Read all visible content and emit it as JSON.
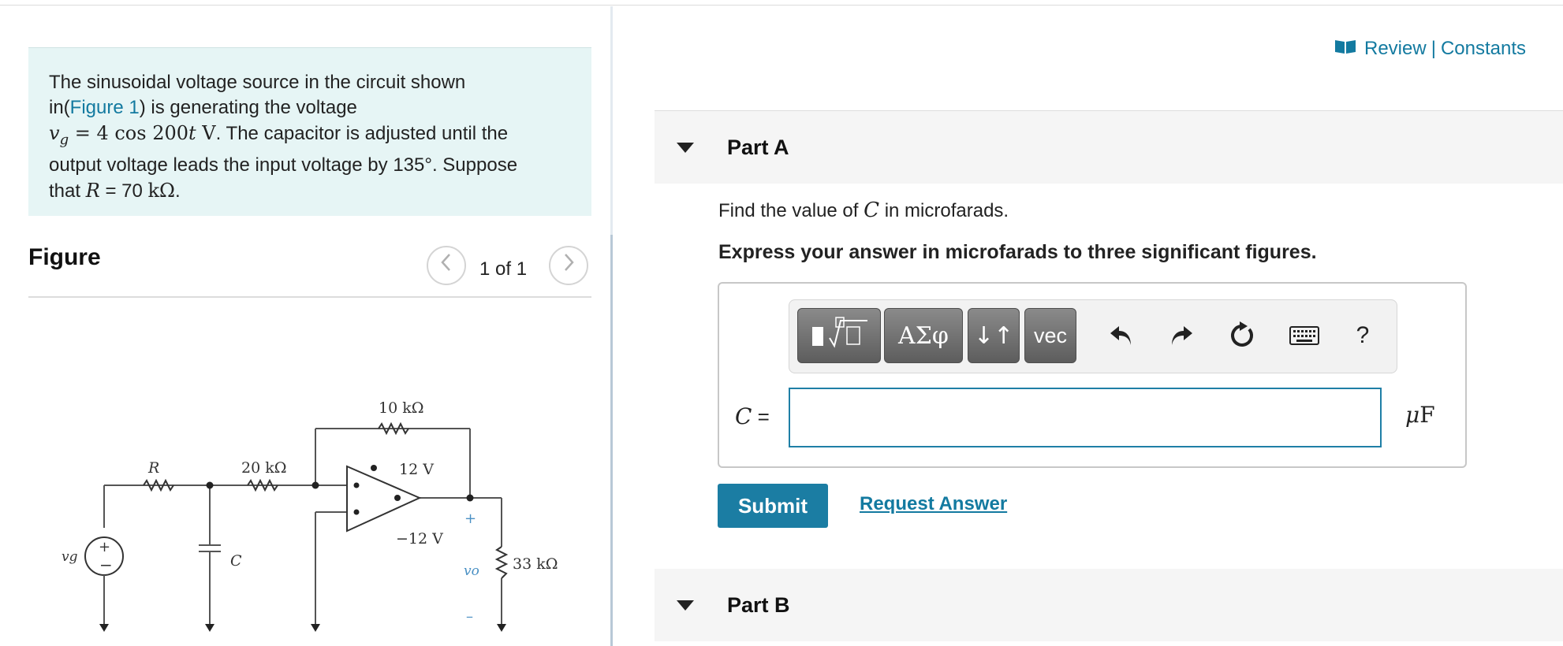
{
  "problem": {
    "line1": "The sinusoidal voltage source in the circuit shown",
    "line2_pre": "in(",
    "figure_link": "Figure 1",
    "line2_post": ") is generating the voltage",
    "math_vg": "v",
    "math_vg_sub": "g",
    "math_eq": " = 4 cos 200",
    "math_t": "t",
    "math_v": " V",
    "line3_post": ". The capacitor is adjusted until the",
    "line4": "output voltage leads the input voltage by 135°. Suppose",
    "line5_pre": "that ",
    "math_R": "R",
    "line5_eq": " = 70 ",
    "math_kohm": "kΩ",
    "line5_post": "."
  },
  "figure": {
    "title": "Figure",
    "pager_text": "1 of 1",
    "prev_icon": "chevron-left-icon",
    "next_icon": "chevron-right-icon",
    "labels": {
      "r_feedback": "10 kΩ",
      "r": "R",
      "r_20k": "20 kΩ",
      "v_pos": "12 V",
      "v_neg": "−12 V",
      "c": "C",
      "vg": "vg",
      "vo": "vo",
      "r_load": "33 kΩ",
      "plus": "+",
      "minus": "−",
      "plus_small": "+",
      "minus_small": "–"
    }
  },
  "header": {
    "review": "Review",
    "separator": "|",
    "constants": "Constants",
    "review_icon": "book-icon"
  },
  "parts": [
    {
      "title": "Part A"
    },
    {
      "title": "Part B"
    }
  ],
  "partA": {
    "question_pre": "Find the value of ",
    "question_var": "C",
    "question_post": " in microfarads.",
    "instructions": "Express your answer in microfarads to three significant figures.",
    "var_label_var": "C",
    "var_label_eq": " =",
    "input_value": "",
    "unit_mu": "μ",
    "unit_F": "F",
    "toolbar": {
      "templates": "templates",
      "greek": "ΑΣφ",
      "arrows": "↓↑",
      "vec": "vec",
      "help": "?"
    },
    "submit": "Submit",
    "request_answer": "Request Answer"
  }
}
